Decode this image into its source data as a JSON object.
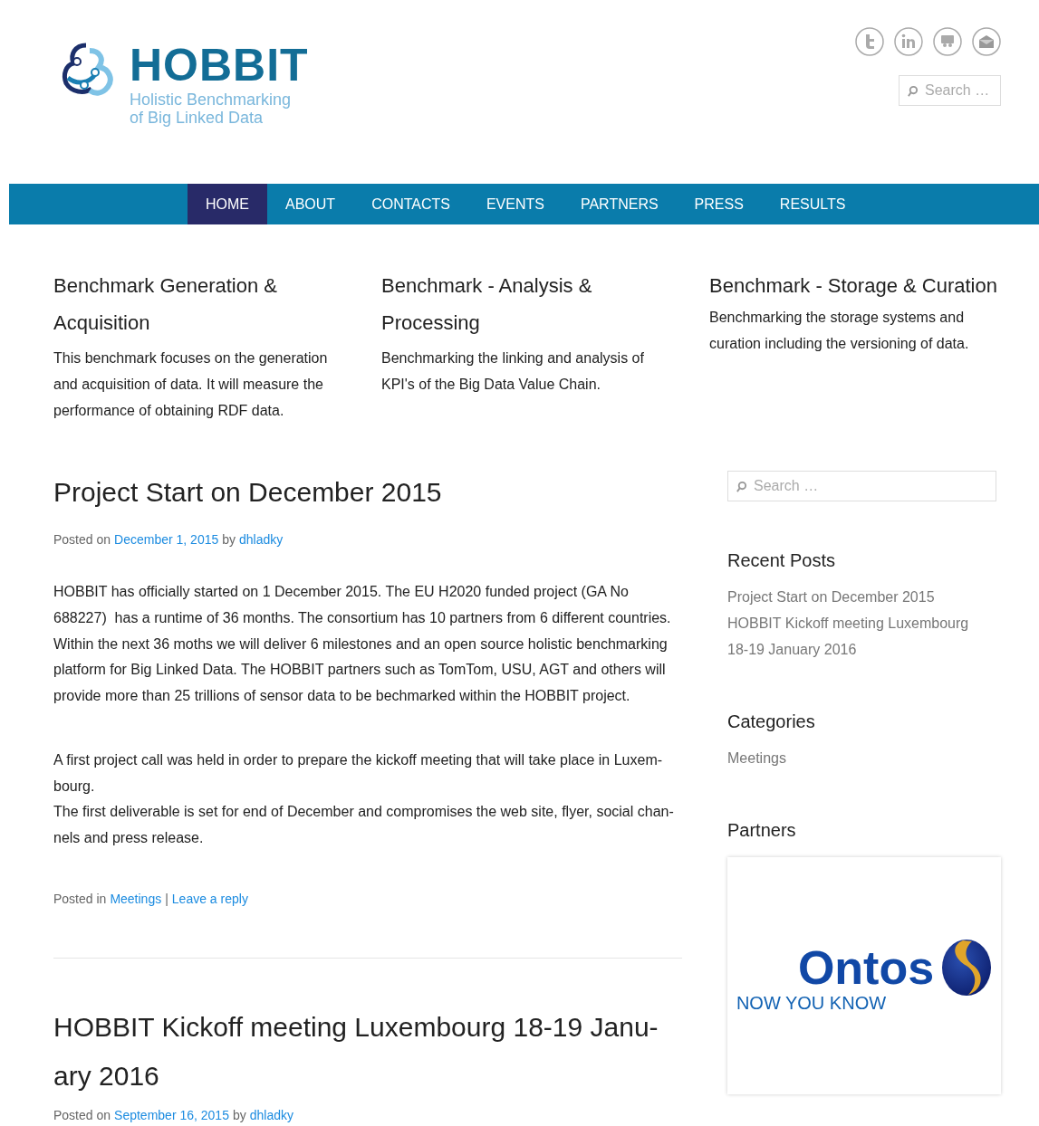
{
  "logo": {
    "name": "HOBBIT",
    "tagline_lines": [
      "Holistic Benchmarking",
      "of Big Linked Data"
    ]
  },
  "social_icons": [
    {
      "kind": "twitter"
    },
    {
      "kind": "linkedin"
    },
    {
      "kind": "slideshare"
    },
    {
      "kind": "mail"
    }
  ],
  "header_search": {
    "placeholder": "Search …"
  },
  "nav": [
    {
      "label": "HOME",
      "selected": true
    },
    {
      "label": "ABOUT",
      "selected": false
    },
    {
      "label": "CONTACTS",
      "selected": false
    },
    {
      "label": "EVENTS",
      "selected": false
    },
    {
      "label": "PARTNERS",
      "selected": false
    },
    {
      "label": "PRESS",
      "selected": false
    },
    {
      "label": "RESULTS",
      "selected": false
    }
  ],
  "features": [
    {
      "title": "Benchmark Generation & Acquisition",
      "text": "This benchmark focuses on the generation and acquisition of data. It will measure the performance of obtaining RDF data."
    },
    {
      "title": "Benchmark - Analysis & Processing",
      "text": "Benchmarking the linking and analysis of KPI's of the Big Data Value Chain."
    },
    {
      "title": "Benchmark - Storage & Curation",
      "text": "Benchmarking the storage systems and curation including the versioning of data."
    }
  ],
  "posts": [
    {
      "title_lines": [
        "Project Start on December 2015"
      ],
      "posted_on": "Posted on",
      "date": "December 1, 2015",
      "by": "by",
      "author": "dhladky",
      "paragraphs": [
        [
          "HOBBIT has officially started on 1 December 2015. The EU H2020 funded project (GA No",
          "688227)  has a runtime of 36 months. The consortium has 10 partners from 6 different countries.",
          "Within the next 36 moths we will deliver 6 milestones and an open source holistic benchmarking",
          "platform for Big Linked Data. The HOBBIT partners such as TomTom, USU, AGT and others will",
          "provide more than 25 trillions of sensor data to be bechmarked within the HOBBIT project."
        ],
        [
          "A first project call was held in order to prepare the kickoff meeting that will take place in Luxem-",
          "bourg.",
          "The first deliverable is set for end of December and compromises the web site, flyer, social chan-",
          "nels and press release."
        ]
      ],
      "posted_in": "Posted in",
      "category": "Meetings",
      "separator": "|",
      "reply": "Leave a reply"
    },
    {
      "title_lines": [
        "HOBBIT Kickoff meeting Luxembourg 18-19 Janu-",
        "ary 2016"
      ],
      "posted_on": "Posted on",
      "date": "September 16, 2015",
      "by": "by",
      "author": "dhladky"
    }
  ],
  "sidebar": {
    "search": {
      "placeholder": "Search …"
    },
    "recent_posts": {
      "title": "Recent Posts",
      "items": [
        "Project Start on December 2015",
        "HOBBIT Kickoff meeting Luxembourg 18-19 January 2016"
      ]
    },
    "categories": {
      "title": "Categories",
      "items": [
        "Meetings"
      ]
    },
    "partners": {
      "title": "Partners",
      "logo_name": "Ontos",
      "logo_slogan": "NOW YOU KNOW"
    }
  }
}
